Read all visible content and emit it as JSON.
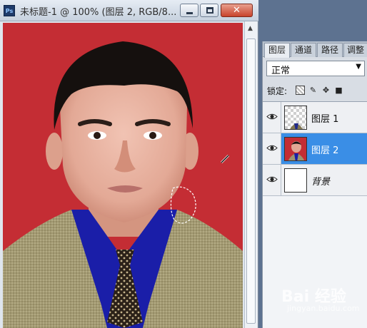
{
  "document": {
    "app_icon": "Ps",
    "title": "未标题-1 @ 100% (图层 2, RGB/8..."
  },
  "panel": {
    "tabs": [
      "图层",
      "通道",
      "路径",
      "调整"
    ],
    "blend_mode": "正常",
    "lock_label": "锁定:",
    "lock_icons": [
      "lock-transparent-icon",
      "lock-paint-icon",
      "lock-move-icon",
      "lock-all-icon"
    ],
    "layers": [
      {
        "name": "图层 1",
        "visible": true,
        "selected": false,
        "thumbnail": "transparent"
      },
      {
        "name": "图层 2",
        "visible": true,
        "selected": true,
        "thumbnail": "portrait"
      },
      {
        "name": "背景",
        "visible": true,
        "selected": false,
        "thumbnail": "white"
      }
    ]
  },
  "watermark": {
    "logo": "Bai 经验",
    "url": "jingyan.baidu.com"
  },
  "colors": {
    "canvas_background": "#c42d34",
    "selected_layer": "#3a8ee6",
    "close_button": "#c8432c"
  }
}
